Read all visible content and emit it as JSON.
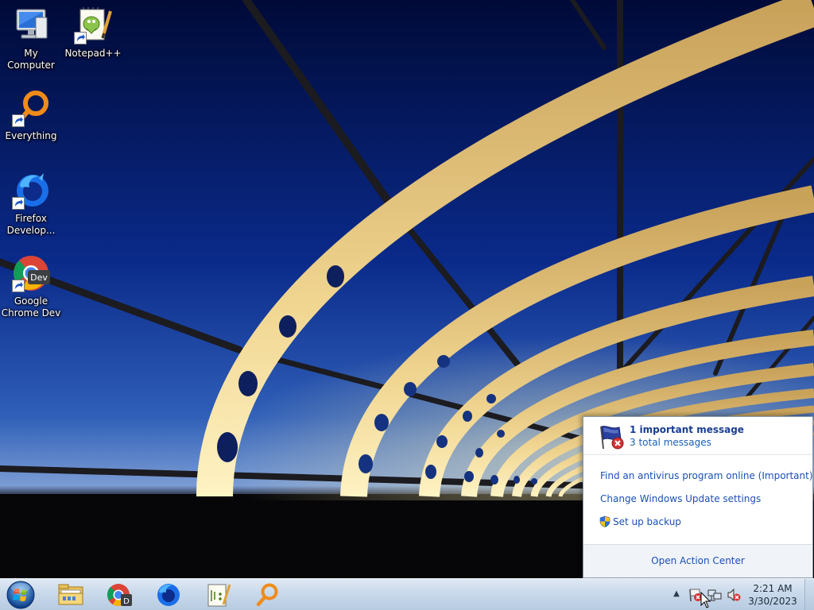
{
  "desktop": {
    "icons": [
      {
        "label": "My Computer"
      },
      {
        "label": "Notepad++"
      },
      {
        "label": "Everything"
      },
      {
        "label": "Firefox\nDevelop..."
      },
      {
        "label": "Google\nChrome Dev"
      }
    ]
  },
  "action_center": {
    "header_title": "1 important message",
    "header_subtitle": "3 total messages",
    "links": [
      {
        "label": "Find an antivirus program online (Important)"
      },
      {
        "label": "Change Windows Update settings"
      },
      {
        "label": "Set up backup",
        "icon": "uac-shield-icon"
      }
    ],
    "footer_link": "Open Action Center"
  },
  "taskbar": {
    "pinned": [
      {
        "name": "Windows Explorer",
        "icon": "folder-icon"
      },
      {
        "name": "Google Chrome Dev",
        "icon": "chrome-dev-icon"
      },
      {
        "name": "Firefox Developer Edition",
        "icon": "firefox-icon"
      },
      {
        "name": "Notepad++",
        "icon": "notepad-plus-plus-icon"
      },
      {
        "name": "Everything",
        "icon": "everything-search-icon"
      }
    ],
    "tray": {
      "overflow": "▲",
      "icons": [
        "action-center-flag-icon",
        "network-icon",
        "volume-muted-icon"
      ]
    },
    "clock": {
      "time": "2:21 AM",
      "date": "3/30/2023"
    }
  },
  "colors": {
    "sky_top": "#000a38",
    "sky_bottom": "#4e7cc4",
    "link_blue": "#1b4fb8",
    "taskbar": "#c9d9ea"
  }
}
